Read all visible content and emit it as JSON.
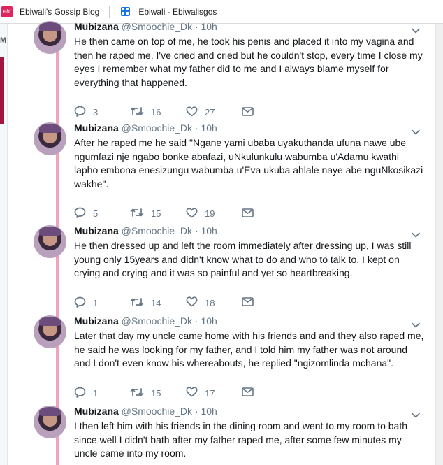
{
  "bookmarks": [
    {
      "label": "Ebiwali's Gossip Blog",
      "icon": "ebiwali-favicon"
    },
    {
      "label": "Ebiwali - Ebiwalisgos",
      "icon": "blogger-favicon"
    }
  ],
  "left_sidebar": {
    "letter": "M"
  },
  "tweets": [
    {
      "name": "Mubizana",
      "handle": "@Smoochie_Dk",
      "time": "· 10h",
      "lines": [
        "He then came on top of me, he took his penis and placed it into my vagina and",
        "then he raped me, I've cried and cried but he couldn't stop, every time I close my",
        "eyes I remember what my father did to me and I always blame myself for",
        "everything that happened."
      ],
      "replies": "3",
      "retweets": "16",
      "likes": "27"
    },
    {
      "name": "Mubizana",
      "handle": "@Smoochie_Dk",
      "time": "· 10h",
      "lines": [
        "After he raped me he said \"Ngane yami ubaba uyakuthanda ufuna nawe ube",
        "ngumfazi nje ngabo bonke abafazi, uNkulunkulu wabumba u'Adamu kwathi",
        "lapho embona enesizungu wabumba u'Eva ukuba ahlale naye abe nguNkosikazi",
        "wakhe\"."
      ],
      "replies": "5",
      "retweets": "15",
      "likes": "19"
    },
    {
      "name": "Mubizana",
      "handle": "@Smoochie_Dk",
      "time": "· 10h",
      "lines": [
        "He then dressed up and left the room immediately after dressing up, I was still",
        "young only 15years and didn't know what to do and who to talk to, I kept on",
        "crying and crying and it was so painful and yet so heartbreaking."
      ],
      "replies": "1",
      "retweets": "14",
      "likes": "18"
    },
    {
      "name": "Mubizana",
      "handle": "@Smoochie_Dk",
      "time": "· 10h",
      "lines": [
        "Later that day my uncle came home with his friends and and they also raped me,",
        "he said he was looking for my father, and I told him my father was not around",
        "and I don't even know his whereabouts, he replied \"ngizomlinda mchana\"."
      ],
      "replies": "1",
      "retweets": "15",
      "likes": "17"
    },
    {
      "name": "Mubizana",
      "handle": "@Smoochie_Dk",
      "time": "· 10h",
      "lines": [
        "I then left him with his friends in the dining room and went to my room to bath",
        "since well I didn't bath after my father raped me, after some few minutes my",
        "uncle came into my room."
      ],
      "replies": "",
      "retweets": "",
      "likes": ""
    }
  ],
  "colors": {
    "thread": "#f0a3bd",
    "icon": "#657786",
    "text": "#14171a",
    "brand": "#e0245e"
  }
}
